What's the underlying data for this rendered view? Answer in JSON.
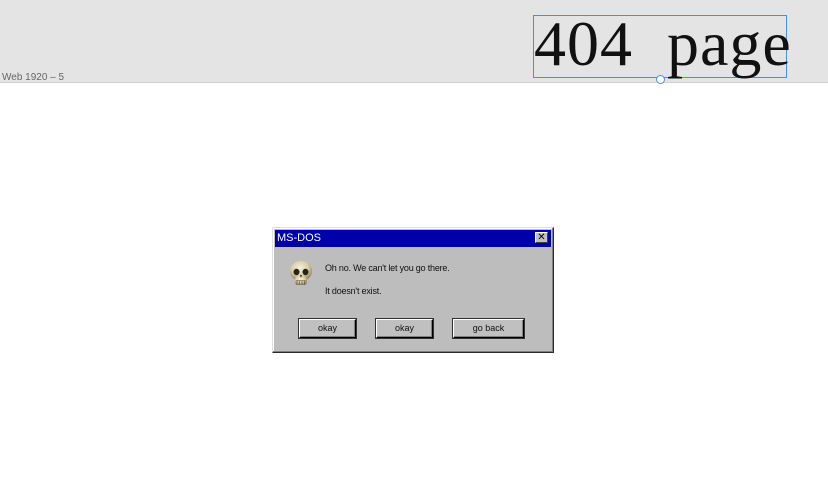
{
  "canvas": {
    "artboard_label": "Web 1920 – 5",
    "selected_text": "404  page"
  },
  "dialog": {
    "title": "MS-DOS",
    "close_glyph": "✕",
    "icon": "skull-icon",
    "message_line1": "Oh no. We can't let you go there.",
    "message_line2": "It doesn't exist.",
    "buttons": {
      "ok1": "okay",
      "ok2": "okay",
      "back": "go back"
    },
    "colors": {
      "titlebar": "#0000aa",
      "body": "#bdbdbd"
    }
  }
}
